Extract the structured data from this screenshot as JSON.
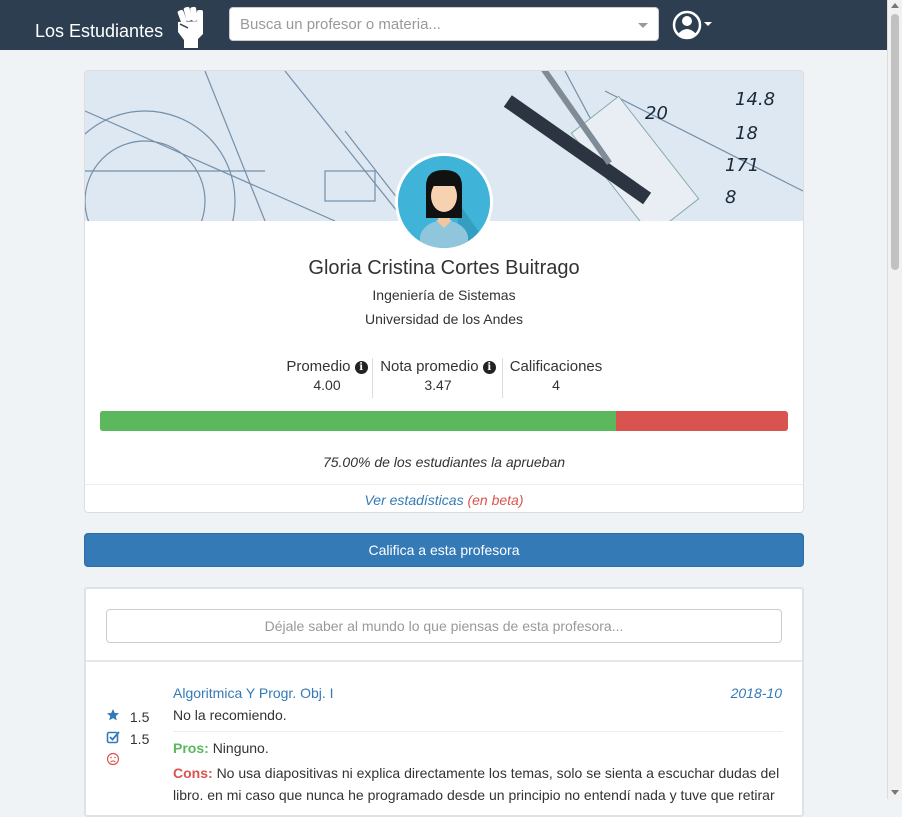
{
  "navbar": {
    "brand": "Los Estudiantes",
    "search_placeholder": "Busca un profesor o materia..."
  },
  "profile": {
    "name": "Gloria Cristina Cortes Buitrago",
    "department": "Ingeniería de Sistemas",
    "university": "Universidad de los Andes",
    "stats": [
      {
        "label": "Promedio",
        "value": "4.00",
        "info": true
      },
      {
        "label": "Nota promedio",
        "value": "3.47",
        "info": true
      },
      {
        "label": "Calificaciones",
        "value": "4",
        "info": false
      }
    ],
    "approval_fraction": 0.75,
    "approval_text": "75.00% de los estudiantes la aprueban",
    "stats_link": "Ver estadísticas",
    "beta_label": "(en beta)"
  },
  "rate_button": "Califica a esta profesora",
  "comment_placeholder": "Déjale saber al mundo lo que piensas de esta profesora...",
  "review": {
    "course": "Algoritmica Y Progr. Obj. I",
    "date": "2018-10",
    "recommendation": "No la recomiendo.",
    "rating": "1.5",
    "grade": "1.5",
    "pros_label": "Pros:",
    "pros": "Ninguno.",
    "cons_label": "Cons:",
    "cons": "No usa diapositivas ni explica directamente los temas, solo se sienta a escuchar dudas del libro. en mi caso que nunca he programado desde un principio no entendí nada y tuve que retirar"
  },
  "colors": {
    "navbar": "#2c3e50",
    "primary": "#337ab7",
    "success": "#5cb85c",
    "danger": "#d9534f"
  },
  "icons": [
    "fist-logo-icon",
    "user-icon",
    "info-icon",
    "star-icon",
    "checkbox-icon",
    "frown-icon"
  ]
}
